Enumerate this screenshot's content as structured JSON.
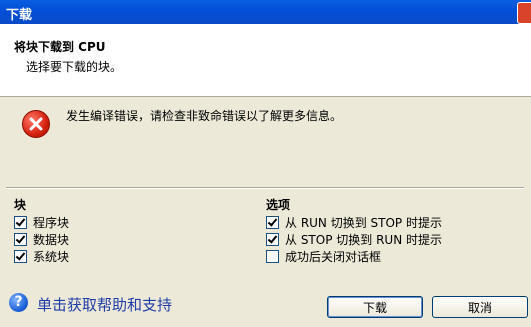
{
  "window": {
    "title": "下载"
  },
  "header": {
    "title": "将块下载到 CPU",
    "subtitle": "选择要下载的块。"
  },
  "error": {
    "message": "发生编译错误，请检查非致命错误以了解更多信息。"
  },
  "blocks": {
    "title": "块",
    "items": [
      {
        "label": "程序块",
        "checked": true
      },
      {
        "label": "数据块",
        "checked": true
      },
      {
        "label": "系统块",
        "checked": true
      }
    ]
  },
  "options": {
    "title": "选项",
    "items": [
      {
        "label": "从 RUN 切换到 STOP 时提示",
        "checked": true
      },
      {
        "label": "从 STOP 切换到 RUN 时提示",
        "checked": true
      },
      {
        "label": "成功后关闭对话框",
        "checked": false
      }
    ]
  },
  "help": {
    "icon": "?",
    "label": "单击获取帮助和支持"
  },
  "buttons": {
    "download": "下载",
    "cancel": "取消"
  },
  "colors": {
    "titlebar": "#0a5fe0",
    "dialog_bg": "#ece9d8",
    "help_link": "#1f3ca8",
    "error_icon": "#d4200e"
  }
}
